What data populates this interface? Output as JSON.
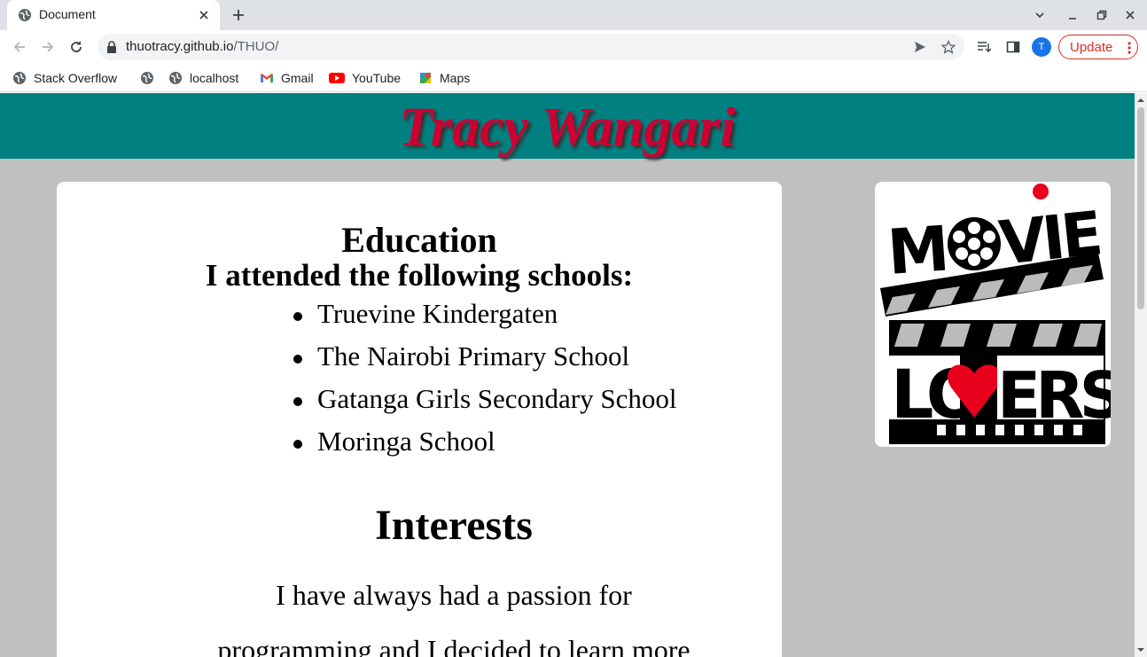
{
  "browser": {
    "tab_title": "Document",
    "url_host": "thuotracy.github.io",
    "url_path": "/THUO/",
    "profile_initial": "T",
    "update_label": "Update",
    "bookmarks": [
      "Stack Overflow",
      "localhost",
      "Gmail",
      "YouTube",
      "Maps"
    ]
  },
  "page": {
    "site_title": "Tracy Wangari",
    "education_title": "Education",
    "education_subtitle": "I attended the following schools:",
    "schools": [
      "Truevine Kindergaten",
      "The Nairobi Primary School",
      "Gatanga Girls Secondary School",
      "Moringa School"
    ],
    "interests_title": "Interests",
    "interests_line1": "I have always had a passion for",
    "interests_line2": "programming and I decided to learn more",
    "logo_text_top": "MOVIE",
    "logo_text_bottom": "LOVERS"
  },
  "colors": {
    "header_bg": "#008080",
    "title_color": "#cc0033",
    "page_bg": "#c0c0c0"
  }
}
